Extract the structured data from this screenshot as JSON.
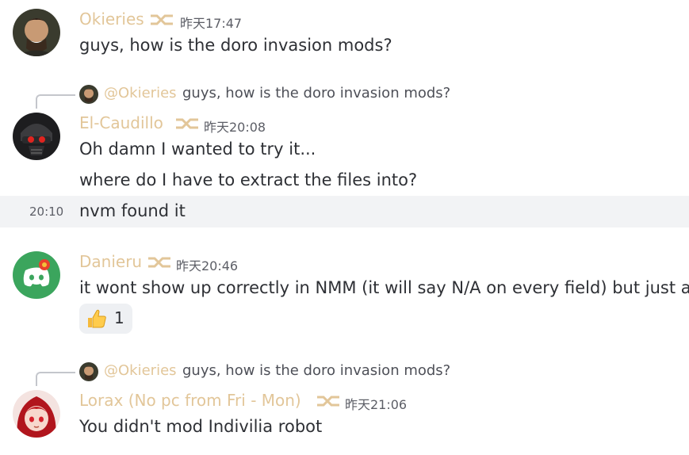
{
  "messages": [
    {
      "username": "Okieries",
      "timestamp": "昨天17:47",
      "lines": [
        "guys, how is the doro invasion mods?"
      ]
    },
    {
      "reply": {
        "name": "@Okieries",
        "text": "guys, how is the doro invasion mods?"
      },
      "username": "El-Caudillo",
      "timestamp": "昨天20:08",
      "lines": [
        "Oh damn I wanted to try it...",
        "where do I have to extract the files into?"
      ]
    },
    {
      "side_time": "20:10",
      "text": "nvm found it"
    },
    {
      "username": "Danieru",
      "timestamp": "昨天20:46",
      "lines": [
        "it wont show up correctly in NMM (it will say N/A on every field) but just acti"
      ],
      "reaction": {
        "emoji": "thumbs-up-icon",
        "count": "1"
      }
    },
    {
      "reply": {
        "name": "@Okieries",
        "text": "guys, how is the doro invasion mods?"
      },
      "username": "Lorax (No pc from Fri - Mon)",
      "timestamp": "昨天21:06",
      "lines": [
        "You didn't mod Indivilia robot"
      ]
    }
  ],
  "colors": {
    "username": "#e2c699",
    "highlight": "#f2f3f5",
    "text": "#2e3035"
  }
}
